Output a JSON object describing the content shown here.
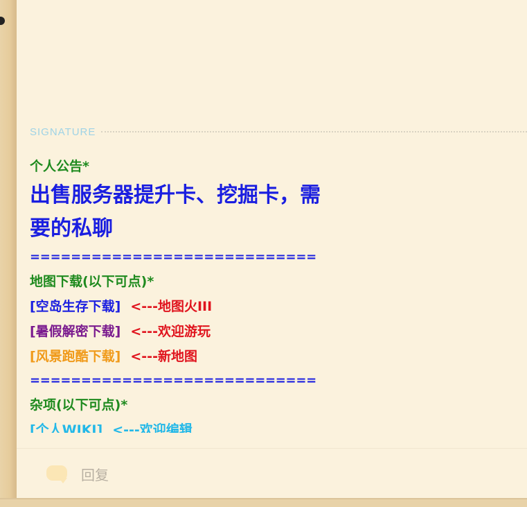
{
  "signature": {
    "label": "SIGNATURE",
    "lines": {
      "announce_title": "个人公告*",
      "big_1": "出售服务器提升卡、挖掘卡，需",
      "big_2": "要的私聊",
      "rule_1": "============================",
      "map_title": "地图下载(以下可点)*",
      "item1_link": "[空岛生存下载]",
      "item1_note": "<---地图火III",
      "item2_link": "[暑假解密下载]",
      "item2_note": "<---欢迎游玩",
      "item3_link": "[风景跑酷下载]",
      "item3_note": "<---新地图",
      "rule_2": "============================",
      "misc_title": "杂项(以下可点)*",
      "item4_link": "[个人WIKI]",
      "item4_note": "<---欢迎编辑"
    }
  },
  "footer": {
    "reply_label": "回复"
  },
  "colors": {
    "background": "#fbf2dd",
    "green": "#1e8a1e",
    "blue": "#1a1ee0",
    "purple": "#7a1a8e",
    "orange": "#f09a1a",
    "red": "#e0141e",
    "cyan": "#22b8e8",
    "signature_label": "#9fd3e6"
  },
  "icons": {
    "reply": "speech-bubble-icon"
  }
}
